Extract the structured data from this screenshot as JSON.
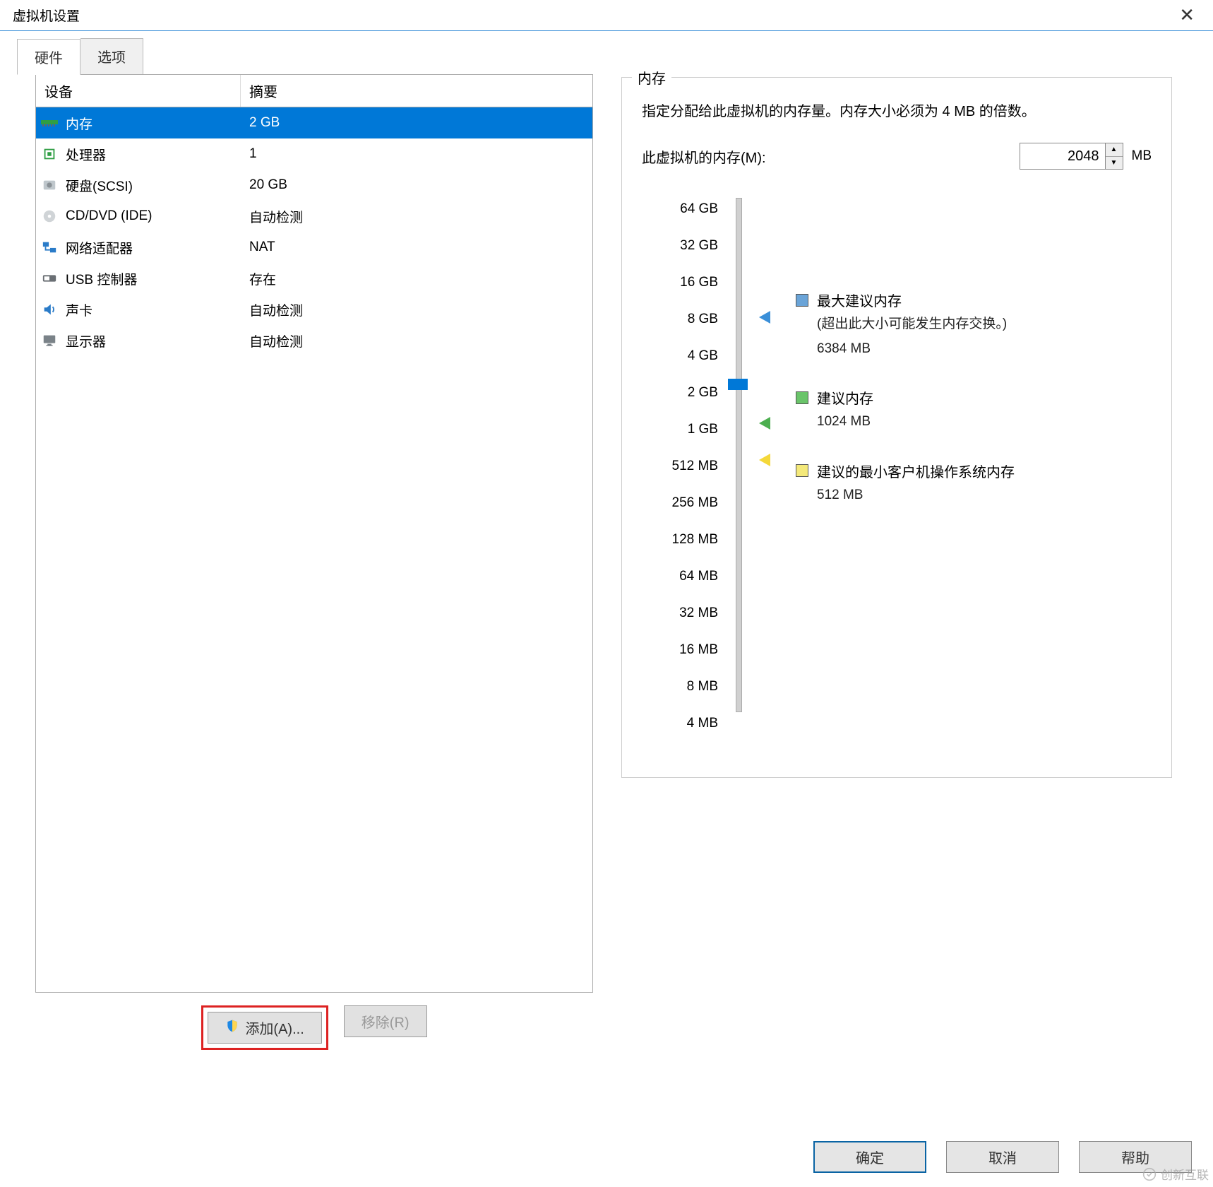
{
  "window": {
    "title": "虚拟机设置"
  },
  "tabs": {
    "hardware": "硬件",
    "options": "选项"
  },
  "devices": {
    "header_device": "设备",
    "header_summary": "摘要",
    "rows": [
      {
        "name": "内存",
        "summary": "2 GB",
        "icon": "memory",
        "selected": true
      },
      {
        "name": "处理器",
        "summary": "1",
        "icon": "cpu"
      },
      {
        "name": "硬盘(SCSI)",
        "summary": "20 GB",
        "icon": "hdd"
      },
      {
        "name": "CD/DVD (IDE)",
        "summary": "自动检测",
        "icon": "cd"
      },
      {
        "name": "网络适配器",
        "summary": "NAT",
        "icon": "net"
      },
      {
        "name": "USB 控制器",
        "summary": "存在",
        "icon": "usb"
      },
      {
        "name": "声卡",
        "summary": "自动检测",
        "icon": "sound"
      },
      {
        "name": "显示器",
        "summary": "自动检测",
        "icon": "display"
      }
    ]
  },
  "leftButtons": {
    "add": "添加(A)...",
    "remove": "移除(R)"
  },
  "memory": {
    "group_label": "内存",
    "description": "指定分配给此虚拟机的内存量。内存大小必须为 4 MB 的倍数。",
    "input_label": "此虚拟机的内存(M):",
    "input_value": "2048",
    "unit": "MB",
    "ticks": [
      "64 GB",
      "32 GB",
      "16 GB",
      "8 GB",
      "4 GB",
      "2 GB",
      "1 GB",
      "512 MB",
      "256 MB",
      "128 MB",
      "64 MB",
      "32 MB",
      "16 MB",
      "8 MB",
      "4 MB"
    ],
    "legend": {
      "max_title": "最大建议内存",
      "max_sub1": "(超出此大小可能发生内存交换。)",
      "max_value": "6384 MB",
      "rec_title": "建议内存",
      "rec_value": "1024 MB",
      "min_title": "建议的最小客户机操作系统内存",
      "min_value": "512 MB"
    }
  },
  "bottom": {
    "ok": "确定",
    "cancel": "取消",
    "help": "帮助"
  },
  "watermark": "创新互联"
}
